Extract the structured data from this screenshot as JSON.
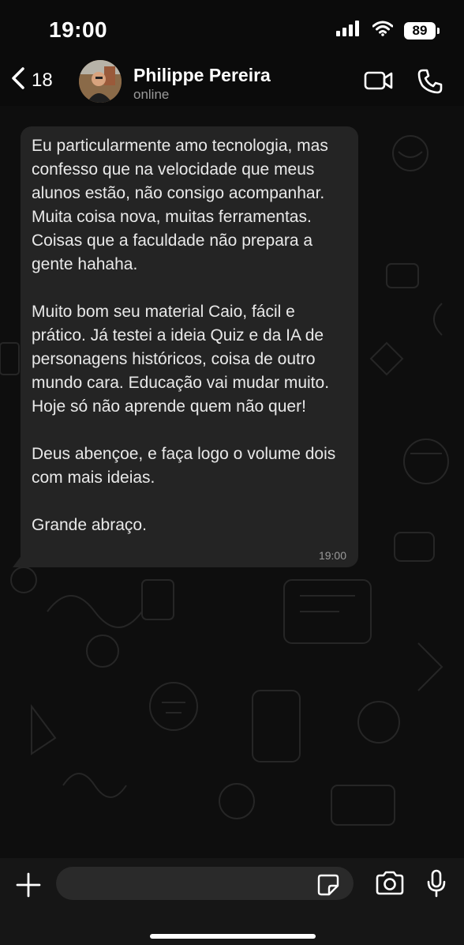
{
  "status_bar": {
    "time": "19:00",
    "battery": "89",
    "icons": [
      "signal-icon",
      "wifi-icon",
      "battery-icon"
    ]
  },
  "header": {
    "back_count": "18",
    "contact_name": "Philippe Pereira",
    "contact_status": "online",
    "icons": [
      "back-chevron-icon",
      "video-call-icon",
      "phone-call-icon"
    ]
  },
  "message": {
    "paragraphs": [
      "Eu particularmente amo tecnologia, mas confesso que na velocidade que meus alunos estão, não consigo acompanhar. Muita coisa nova, muitas ferramentas. Coisas que a faculdade não prepara a gente hahaha.",
      "Muito bom seu material Caio, fácil e prático. Já testei a ideia Quiz e da IA de personagens históricos, coisa de outro mundo cara. Educação vai mudar muito. Hoje só não aprende quem não quer!",
      "Deus abençoe, e faça logo o volume dois com mais ideias.",
      "Grande abraço."
    ],
    "time": "19:00"
  },
  "composer": {
    "input_value": "",
    "icons": [
      "plus-icon",
      "sticker-icon",
      "camera-icon",
      "microphone-icon"
    ]
  },
  "colors": {
    "background": "#0b0b0b",
    "bubble": "#242424",
    "text": "#e9e9e9",
    "muted": "#9a9a9a"
  }
}
